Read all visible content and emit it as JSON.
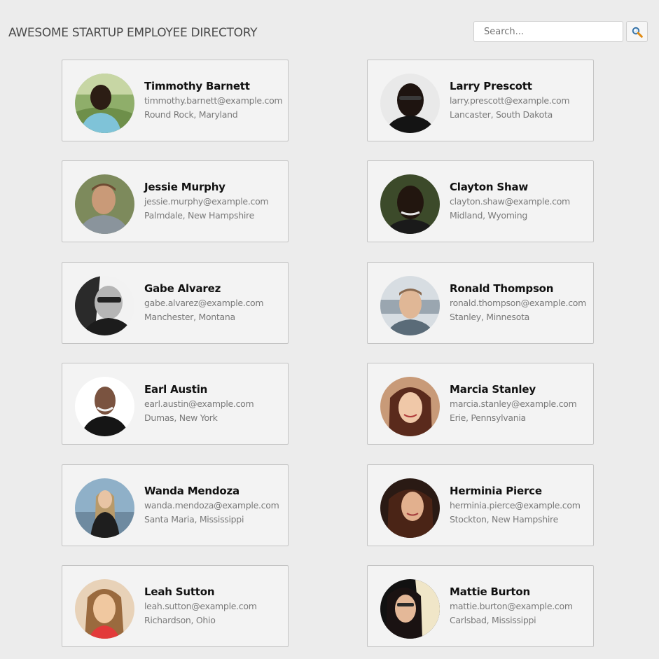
{
  "header": {
    "title": "AWESOME STARTUP EMPLOYEE DIRECTORY"
  },
  "search": {
    "placeholder": "Search...",
    "value": "",
    "button_icon": "magnifier-icon"
  },
  "colors": {
    "page_background": "#ececec",
    "card_background": "#f3f3f3",
    "card_border": "#c4c4c4",
    "name_text": "#111111",
    "detail_text": "#7a7a7a"
  },
  "employees": [
    {
      "name": "Timmothy Barnett",
      "email": "timmothy.barnett@example.com",
      "location": "Round Rock, Maryland"
    },
    {
      "name": "Larry Prescott",
      "email": "larry.prescott@example.com",
      "location": "Lancaster, South Dakota"
    },
    {
      "name": "Jessie Murphy",
      "email": "jessie.murphy@example.com",
      "location": "Palmdale, New Hampshire"
    },
    {
      "name": "Clayton Shaw",
      "email": "clayton.shaw@example.com",
      "location": "Midland, Wyoming"
    },
    {
      "name": "Gabe Alvarez",
      "email": "gabe.alvarez@example.com",
      "location": "Manchester, Montana"
    },
    {
      "name": "Ronald Thompson",
      "email": "ronald.thompson@example.com",
      "location": "Stanley, Minnesota"
    },
    {
      "name": "Earl Austin",
      "email": "earl.austin@example.com",
      "location": "Dumas, New York"
    },
    {
      "name": "Marcia Stanley",
      "email": "marcia.stanley@example.com",
      "location": "Erie, Pennsylvania"
    },
    {
      "name": "Wanda Mendoza",
      "email": "wanda.mendoza@example.com",
      "location": "Santa Maria, Mississippi"
    },
    {
      "name": "Herminia Pierce",
      "email": "herminia.pierce@example.com",
      "location": "Stockton, New Hampshire"
    },
    {
      "name": "Leah Sutton",
      "email": "leah.sutton@example.com",
      "location": "Richardson, Ohio"
    },
    {
      "name": "Mattie Burton",
      "email": "mattie.burton@example.com",
      "location": "Carlsbad, Mississippi"
    }
  ]
}
